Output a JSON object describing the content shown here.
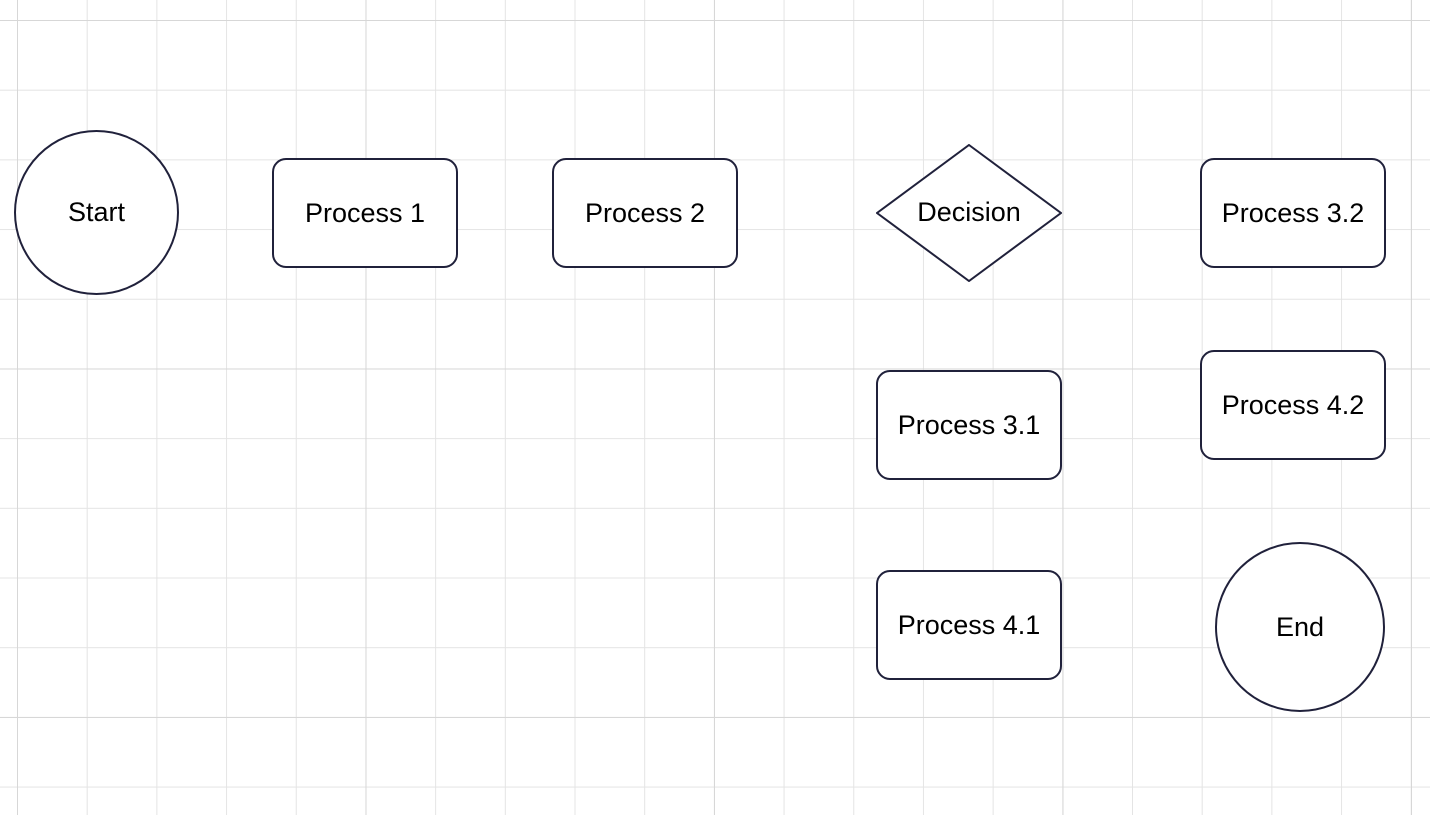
{
  "nodes": {
    "start": {
      "label": "Start"
    },
    "process1": {
      "label": "Process 1"
    },
    "process2": {
      "label": "Process 2"
    },
    "decision": {
      "label": "Decision"
    },
    "process32": {
      "label": "Process 3.2"
    },
    "process31": {
      "label": "Process 3.1"
    },
    "process42": {
      "label": "Process 4.2"
    },
    "process41": {
      "label": "Process 4.1"
    },
    "end": {
      "label": "End"
    }
  },
  "colors": {
    "stroke": "#20213b",
    "grid_minor": "#e4e4e4",
    "grid_major": "#d7d7d7"
  }
}
